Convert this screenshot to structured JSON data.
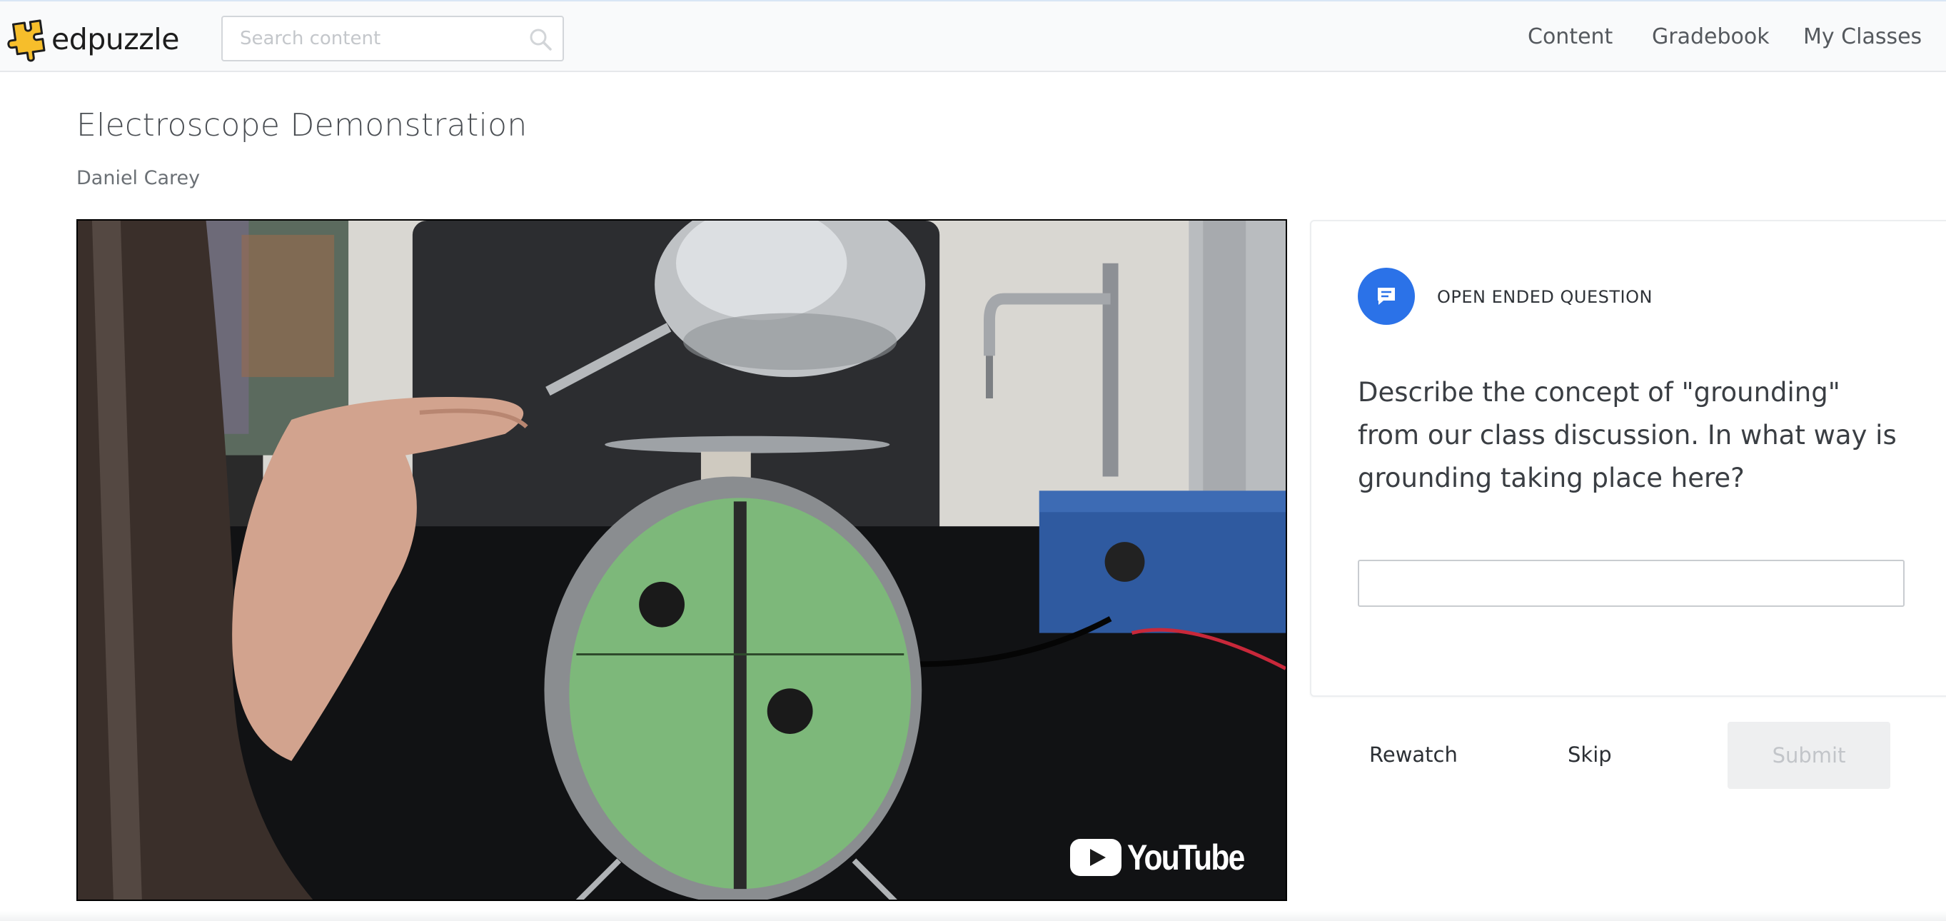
{
  "app": {
    "logo_text": "edpuzzle",
    "brand_color": "#f6be2b"
  },
  "search": {
    "placeholder": "Search content",
    "icon": "search-icon"
  },
  "nav": {
    "items": [
      "Content",
      "Gradebook",
      "My Classes"
    ]
  },
  "lesson": {
    "title": "Electroscope Demonstration",
    "author": "Daniel Carey"
  },
  "video": {
    "provider_label": "YouTube"
  },
  "question": {
    "type_label": "OPEN ENDED QUESTION",
    "icon": "comment-icon",
    "accent_color": "#2b72e8",
    "text": "Describe the concept of \"grounding\" from our class discussion. In what way is grounding taking place here?",
    "answer_value": ""
  },
  "actions": {
    "rewatch": "Rewatch",
    "skip": "Skip",
    "submit": "Submit"
  }
}
